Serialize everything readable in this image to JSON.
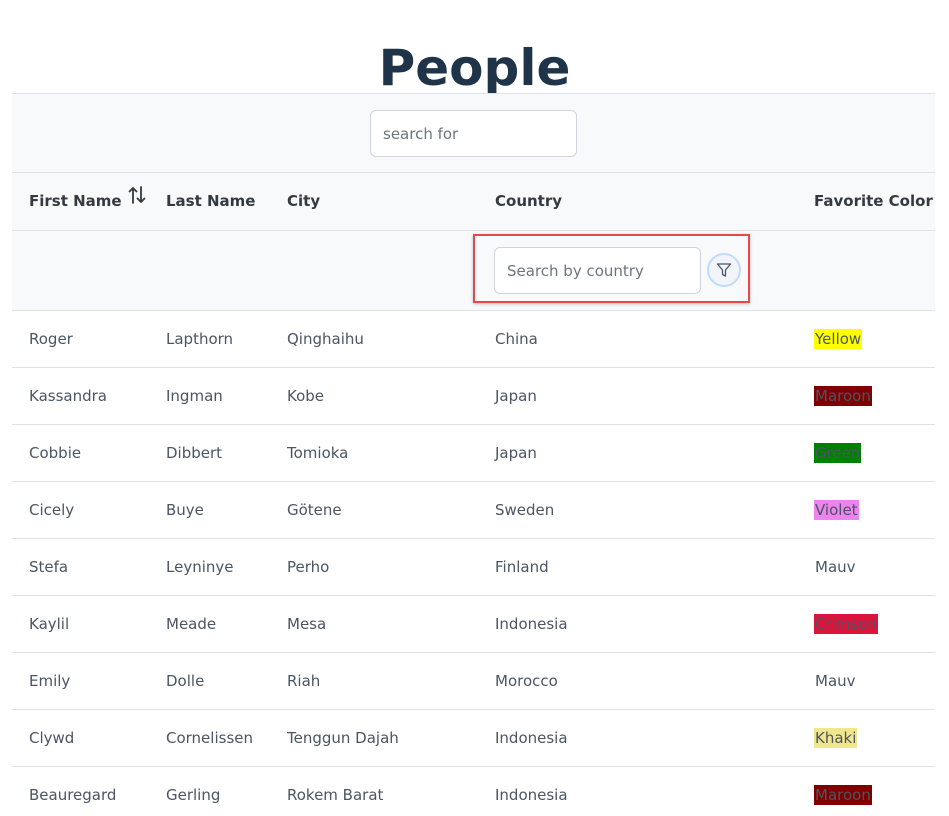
{
  "page": {
    "title": "People"
  },
  "search": {
    "placeholder": "search for"
  },
  "columns": [
    {
      "label": "First Name",
      "sortable": true
    },
    {
      "label": "Last Name"
    },
    {
      "label": "City"
    },
    {
      "label": "Country"
    },
    {
      "label": "Favorite Color"
    }
  ],
  "filters": {
    "country_placeholder": "Search by country"
  },
  "icons": {
    "sort": "sort-arrows-icon",
    "filter": "funnel-filter-icon"
  },
  "colors": {
    "title": "#1f3349",
    "highlight": "#e5484d",
    "header_bg": "#f8f9fa"
  },
  "rows": [
    {
      "first_name": "Roger",
      "last_name": "Lapthorn",
      "city": "Qinghaihu",
      "country": "China",
      "favorite_color": "Yellow",
      "swatch": "#ffff00"
    },
    {
      "first_name": "Kassandra",
      "last_name": "Ingman",
      "city": "Kobe",
      "country": "Japan",
      "favorite_color": "Maroon",
      "swatch": "#800000"
    },
    {
      "first_name": "Cobbie",
      "last_name": "Dibbert",
      "city": "Tomioka",
      "country": "Japan",
      "favorite_color": "Green",
      "swatch": "#008000"
    },
    {
      "first_name": "Cicely",
      "last_name": "Buye",
      "city": "Götene",
      "country": "Sweden",
      "favorite_color": "Violet",
      "swatch": "#ee82ee"
    },
    {
      "first_name": "Stefa",
      "last_name": "Leyninye",
      "city": "Perho",
      "country": "Finland",
      "favorite_color": "Mauv",
      "swatch": ""
    },
    {
      "first_name": "Kaylil",
      "last_name": "Meade",
      "city": "Mesa",
      "country": "Indonesia",
      "favorite_color": "Crimson",
      "swatch": "#dc143c"
    },
    {
      "first_name": "Emily",
      "last_name": "Dolle",
      "city": "Riah",
      "country": "Morocco",
      "favorite_color": "Mauv",
      "swatch": ""
    },
    {
      "first_name": "Clywd",
      "last_name": "Cornelissen",
      "city": "Tenggun Dajah",
      "country": "Indonesia",
      "favorite_color": "Khaki",
      "swatch": "#f0e68c"
    },
    {
      "first_name": "Beauregard",
      "last_name": "Gerling",
      "city": "Rokem Barat",
      "country": "Indonesia",
      "favorite_color": "Maroon",
      "swatch": "#800000"
    }
  ]
}
